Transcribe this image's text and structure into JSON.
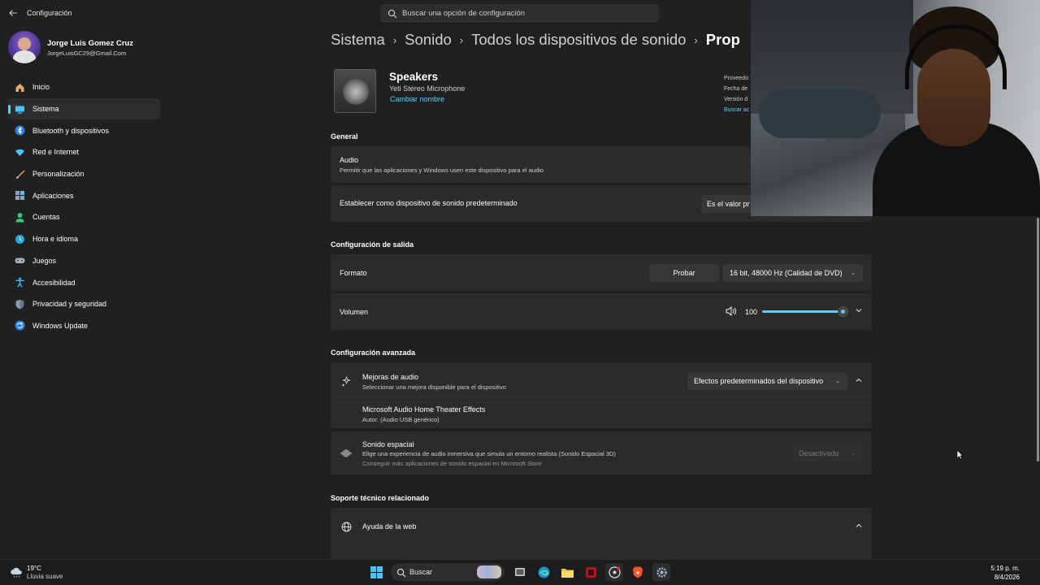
{
  "app": {
    "title": "Configuración"
  },
  "search": {
    "placeholder": "Buscar una opción de configuración"
  },
  "profile": {
    "name": "Jorge Luis Gomez Cruz",
    "email": "JorgeLuisGC29@Gmail.Com"
  },
  "sidebar": {
    "items": [
      {
        "label": "Inicio",
        "icon": "home-icon",
        "active": false
      },
      {
        "label": "Sistema",
        "icon": "monitor-icon",
        "active": true
      },
      {
        "label": "Bluetooth y dispositivos",
        "icon": "bluetooth-icon",
        "active": false
      },
      {
        "label": "Red e Internet",
        "icon": "wifi-icon",
        "active": false
      },
      {
        "label": "Personalización",
        "icon": "brush-icon",
        "active": false
      },
      {
        "label": "Aplicaciones",
        "icon": "apps-icon",
        "active": false
      },
      {
        "label": "Cuentas",
        "icon": "person-icon",
        "active": false
      },
      {
        "label": "Hora e idioma",
        "icon": "globe-clock-icon",
        "active": false
      },
      {
        "label": "Juegos",
        "icon": "gamepad-icon",
        "active": false
      },
      {
        "label": "Accesibilidad",
        "icon": "accessibility-icon",
        "active": false
      },
      {
        "label": "Privacidad y seguridad",
        "icon": "shield-icon",
        "active": false
      },
      {
        "label": "Windows Update",
        "icon": "update-icon",
        "active": false
      }
    ]
  },
  "breadcrumb": [
    "Sistema",
    "Sonido",
    "Todos los dispositivos de sonido",
    "Prop"
  ],
  "device": {
    "name": "Speakers",
    "subtitle": "Yeti Stereo Microphone",
    "rename": "Cambiar nombre",
    "info": [
      "Proveedo",
      "Fecha de",
      "Versión d",
      "Buscar ac"
    ]
  },
  "general": {
    "title": "General",
    "audio_label": "Audio",
    "audio_desc": "Permitir que las aplicaciones y Windows usen este dispositivo para el audio",
    "default_label": "Establecer como dispositivo de sonido predeterminado",
    "default_button": "Es el valor pr"
  },
  "output": {
    "title": "Configuración de salida",
    "format_label": "Formato",
    "test_button": "Probar",
    "format_value": "16 bit, 48000 Hz (Calidad de DVD)",
    "volume_label": "Volumen",
    "volume_value": "100",
    "volume_level": 1.0
  },
  "advanced": {
    "title": "Configuración avanzada",
    "enhance_label": "Mejoras de audio",
    "enhance_desc": "Seleccionar una mejora disponible para el dispositivo",
    "enhance_value": "Efectos predeterminados del dispositivo",
    "effect_name": "Microsoft Audio Home Theater Effects",
    "effect_author": "Autor: (Audio USB genérico)",
    "spatial_label": "Sonido espacial",
    "spatial_desc": "Elige una experiencia de audio inmersiva que simula un entorno realista (Sonido Espacial 3D)",
    "spatial_store": "Conseguir más aplicaciones de sonido espacial en Microsoft Store",
    "spatial_value": "Desactivado"
  },
  "support": {
    "title": "Soporte técnico relacionado",
    "web_help": "Ayuda de la web"
  },
  "taskbar": {
    "temperature": "19°C",
    "weather": "Lluvia suave",
    "search_label": "Buscar",
    "time": "5:19 p. m.",
    "date": "8/4/2026"
  },
  "colors": {
    "accent": "#60cdff",
    "background": "#202020",
    "card": "#2b2b2b"
  }
}
